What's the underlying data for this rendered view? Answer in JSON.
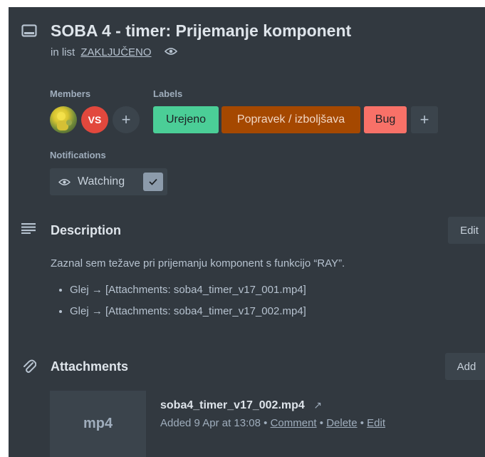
{
  "card": {
    "title": "SOBA 4 - timer: Prijemanje komponent",
    "in_list_prefix": "in list",
    "list_name": "ZAKLJUČENO"
  },
  "members": {
    "heading": "Members",
    "avatar_initials": "VS",
    "add_symbol": "+"
  },
  "labels": {
    "heading": "Labels",
    "items": [
      {
        "text": "Urejeno",
        "color": "#4bce97"
      },
      {
        "text": "Popravek / izboljšava",
        "color": "#a54800"
      },
      {
        "text": "Bug",
        "color": "#f87168"
      }
    ],
    "add_symbol": "+"
  },
  "notifications": {
    "heading": "Notifications",
    "watch_label": "Watching",
    "checked": true
  },
  "description": {
    "heading": "Description",
    "edit_label": "Edit",
    "text": "Zaznal sem težave pri prijemanju komponent s funkcijo “RAY”.",
    "bullets": [
      "Glej → [Attachments: soba4_timer_v17_001.mp4]",
      "Glej → [Attachments: soba4_timer_v17_002.mp4]"
    ]
  },
  "attachments": {
    "heading": "Attachments",
    "add_label": "Add",
    "items": [
      {
        "thumb_label": "mp4",
        "name": "soba4_timer_v17_002.mp4",
        "open_symbol": "↗",
        "added": "Added 9 Apr at 13:08",
        "sep": "•",
        "comment": "Comment",
        "delete": "Delete",
        "edit": "Edit"
      }
    ]
  },
  "icons": [
    "card-icon",
    "eye-icon",
    "check-icon",
    "description-icon",
    "paperclip-icon"
  ],
  "colors": {
    "panel": "#323940",
    "text": "#b6c2cf",
    "heading": "#dee4ea",
    "control": "#3b444c"
  }
}
